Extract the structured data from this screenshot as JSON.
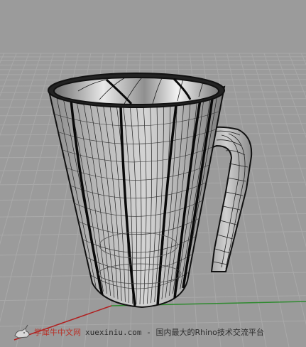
{
  "viewport": {
    "background": "#9b9b9b",
    "grid_color": "#a9a9a9",
    "x_axis_color": "#b02020",
    "y_axis_color": "#2f8a2f",
    "object": "mug-wireframe-shaded"
  },
  "watermark": {
    "brand": "学犀牛中文网",
    "url": "xuexiniu.com",
    "dash": "-",
    "tagline": "国内最大的Rhino技术交流平台",
    "icon": "rhino-logo-icon"
  }
}
